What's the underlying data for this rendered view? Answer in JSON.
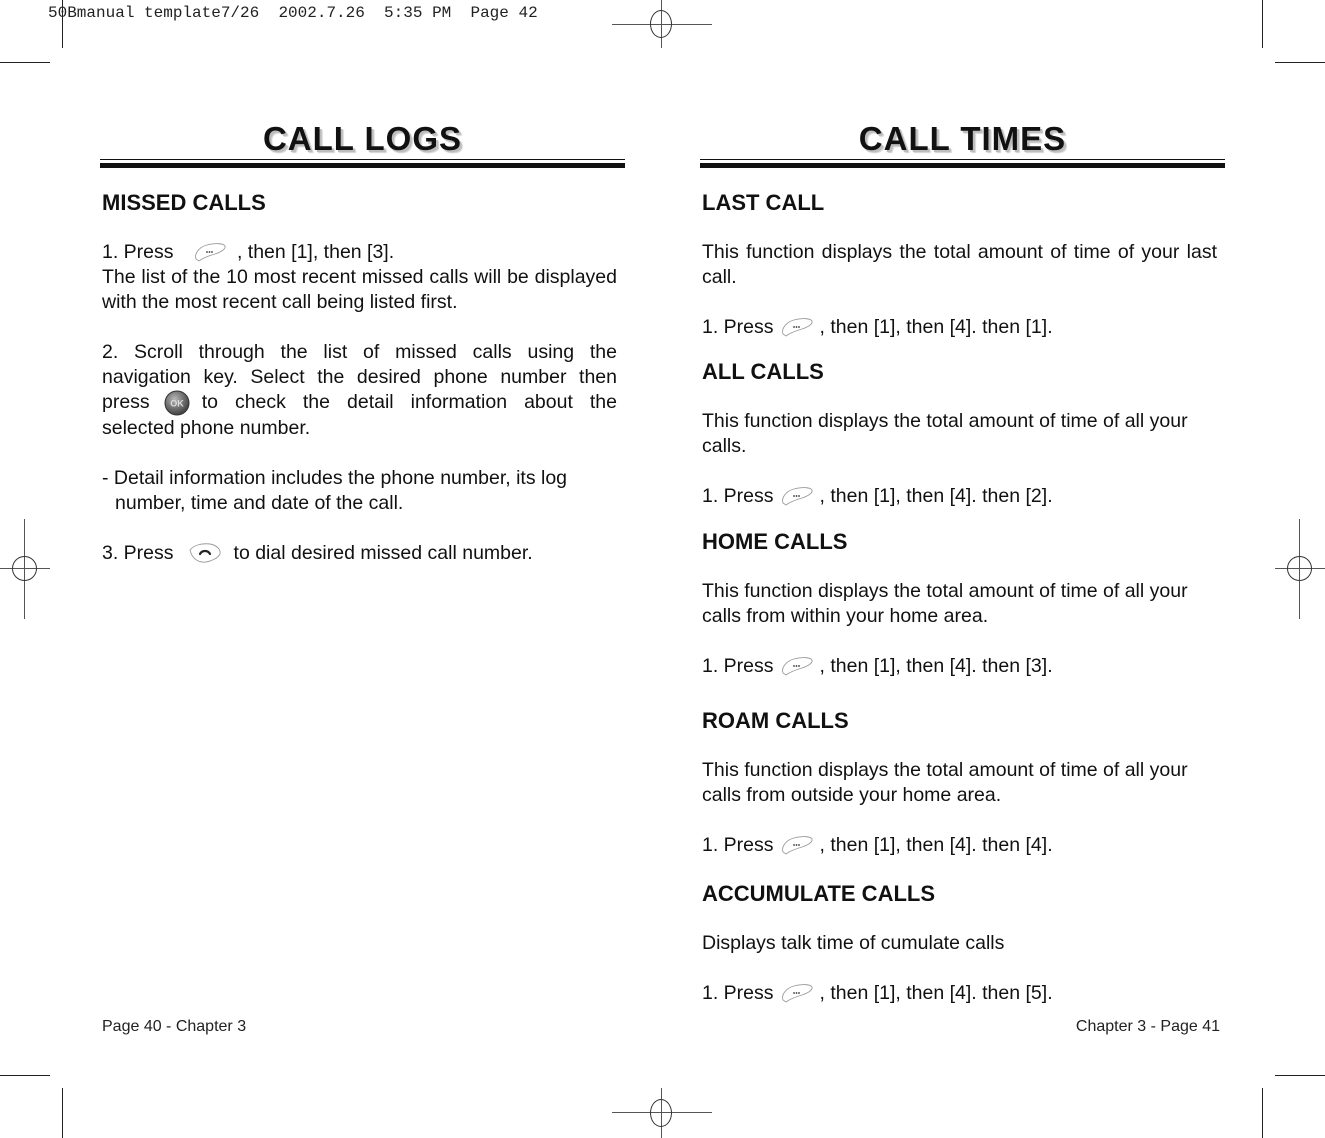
{
  "print_slug": "50Bmanual template7/26  2002.7.26  5:35 PM  Page 42",
  "left_page": {
    "chapter_title": "CALL LOGS",
    "section": {
      "heading": "MISSED CALLS",
      "step1_prefix": "1. Press",
      "step1_suffix": ", then [1], then [3].",
      "step1_desc": "The list of the 10 most recent missed calls will be displayed with the most recent call being listed first.",
      "step2_text": "2. Scroll through the list of missed calls using the navigation key. Select the desired phone number then",
      "step2_press": "press",
      "step2_after": "to check the detail information about the selected phone number.",
      "note": "- Detail information includes the phone number, its log",
      "note_cont": "number, time and date of the call.",
      "step3_prefix": "3. Press",
      "step3_suffix": "to dial desired missed call number."
    },
    "footer": "Page 40 - Chapter 3"
  },
  "right_page": {
    "chapter_title": "CALL TIMES",
    "sections": [
      {
        "heading": "LAST CALL",
        "description": "This function displays the total amount of time of your last call.",
        "press": "1. Press",
        "keys": ", then [1], then [4]. then [1]."
      },
      {
        "heading": "ALL CALLS",
        "description": "This function displays the total amount of time of all your calls.",
        "press": "1. Press",
        "keys": ", then [1], then [4]. then [2]."
      },
      {
        "heading": "HOME CALLS",
        "description": "This function displays the total amount of time of all your calls from within your home area.",
        "press": "1. Press",
        "keys": ", then [1], then [4]. then [3]."
      },
      {
        "heading": "ROAM CALLS",
        "description": "This function displays the total amount of time of all your calls from outside your home area.",
        "press": "1. Press",
        "keys": ", then [1], then [4]. then [4]."
      },
      {
        "heading": "ACCUMULATE CALLS",
        "description": "Displays talk time of cumulate calls",
        "press": "1. Press",
        "keys": ", then [1], then [4]. then [5]."
      }
    ],
    "footer": "Chapter 3 - Page 41"
  },
  "icons": {
    "menu_key": "menu-key-icon",
    "ok_key": "ok-key-icon",
    "send_key": "send-key-icon",
    "registration_mark": "registration-mark-icon"
  }
}
